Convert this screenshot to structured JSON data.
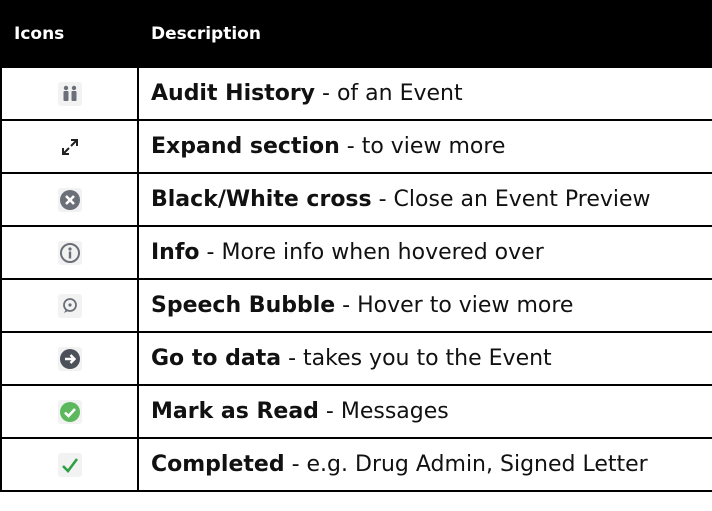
{
  "header": {
    "icons": "Icons",
    "description": "Description"
  },
  "rows": [
    {
      "icon": "audit-history-icon",
      "title": "Audit History",
      "desc": " - of an Event"
    },
    {
      "icon": "expand-icon",
      "title": "Expand section",
      "desc": " - to view more"
    },
    {
      "icon": "cross-icon",
      "title": "Black/White cross",
      "desc": " - Close an Event Preview"
    },
    {
      "icon": "info-icon",
      "title": "Info",
      "desc": " - More info when hovered over"
    },
    {
      "icon": "speech-bubble-icon",
      "title": "Speech Bubble",
      "desc": " - Hover to view more"
    },
    {
      "icon": "go-to-data-icon",
      "title": "Go to data",
      "desc": " - takes you to the Event"
    },
    {
      "icon": "mark-as-read-icon",
      "title": "Mark as Read",
      "desc": " - Messages"
    },
    {
      "icon": "completed-icon",
      "title": "Completed",
      "desc": " - e.g. Drug Admin, Signed Letter"
    }
  ],
  "colors": {
    "header_bg": "#000000",
    "icon_grey": "#6b6f78",
    "green": "#5cb85c",
    "check_green": "#2ea043"
  }
}
